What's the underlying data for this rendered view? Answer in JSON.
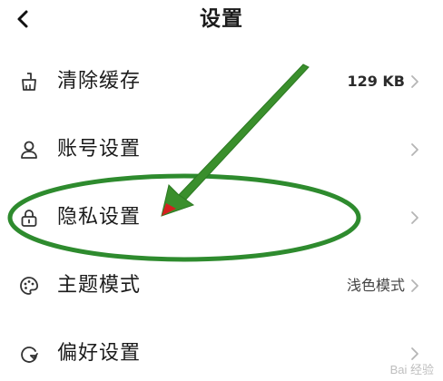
{
  "header": {
    "title": "设置",
    "back_icon": "chevron-left-icon"
  },
  "settings": {
    "items": [
      {
        "label": "清除缓存",
        "value": "129 KB",
        "icon": "broom-icon"
      },
      {
        "label": "账号设置",
        "value": "",
        "icon": "user-icon"
      },
      {
        "label": "隐私设置",
        "value": "",
        "icon": "lock-icon"
      },
      {
        "label": "主题模式",
        "value": "浅色模式",
        "icon": "palette-icon"
      },
      {
        "label": "偏好设置",
        "value": "",
        "icon": "preference-icon"
      }
    ]
  },
  "annotation": {
    "ellipse_color": "#2e8b2e",
    "arrow_color": "#3a8f2c",
    "arrow_tip_color": "#d42020"
  },
  "watermark": {
    "text": "Bai 经验"
  }
}
